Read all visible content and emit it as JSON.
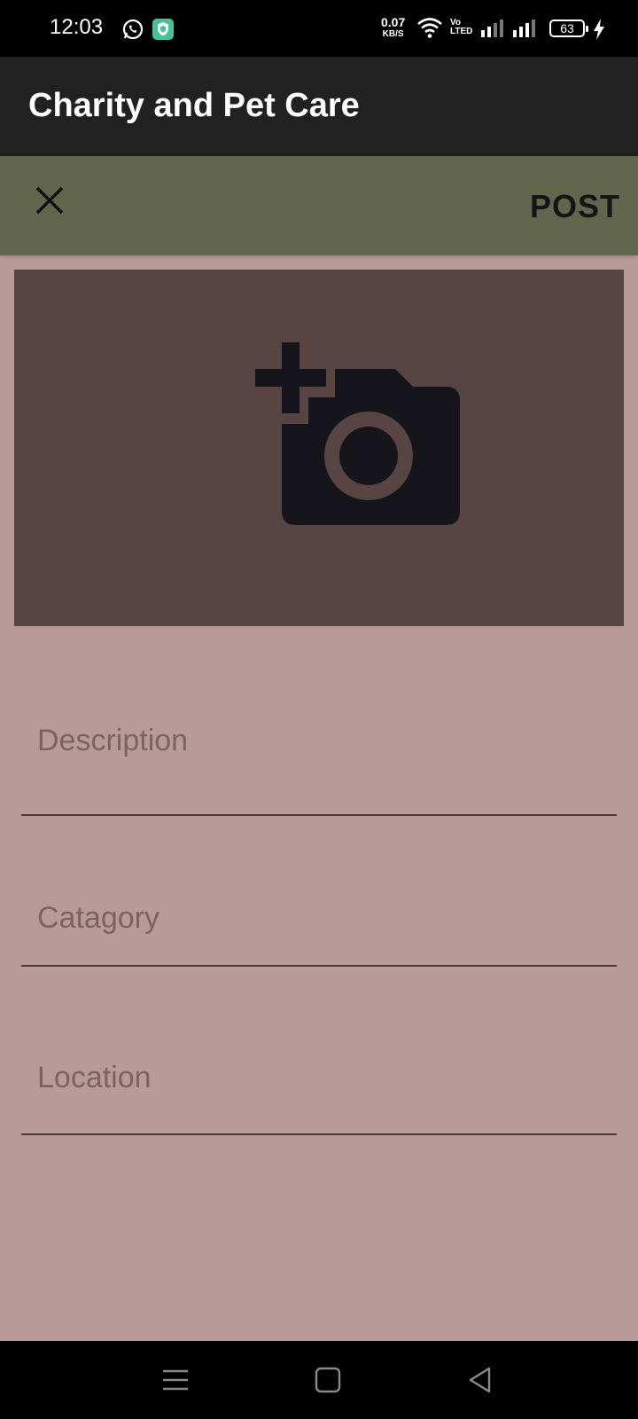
{
  "status_bar": {
    "time": "12:03",
    "net_speed_value": "0.07",
    "net_speed_unit": "KB/S",
    "volte_top": "Vo",
    "volte_bottom": "LTED",
    "battery": "63",
    "icons": [
      "whatsapp-icon",
      "shield-app-icon",
      "wifi-icon",
      "signal-icon",
      "signal-icon",
      "charging-icon"
    ]
  },
  "app_bar": {
    "title": "Charity and Pet Care"
  },
  "toolbar": {
    "close_icon": "close-icon",
    "post_label": "POST",
    "color": "#62664d"
  },
  "image_picker": {
    "icon": "add-a-photo-icon",
    "color": "#584443"
  },
  "form": {
    "description": {
      "placeholder": "Description",
      "value": ""
    },
    "category": {
      "placeholder": "Catagory",
      "value": ""
    },
    "location": {
      "placeholder": "Location",
      "value": ""
    }
  },
  "nav_bar": {
    "icons": [
      "menu-icon",
      "home-square-icon",
      "back-triangle-icon"
    ]
  },
  "colors": {
    "background": "#b89a98",
    "app_bar": "#212121"
  }
}
